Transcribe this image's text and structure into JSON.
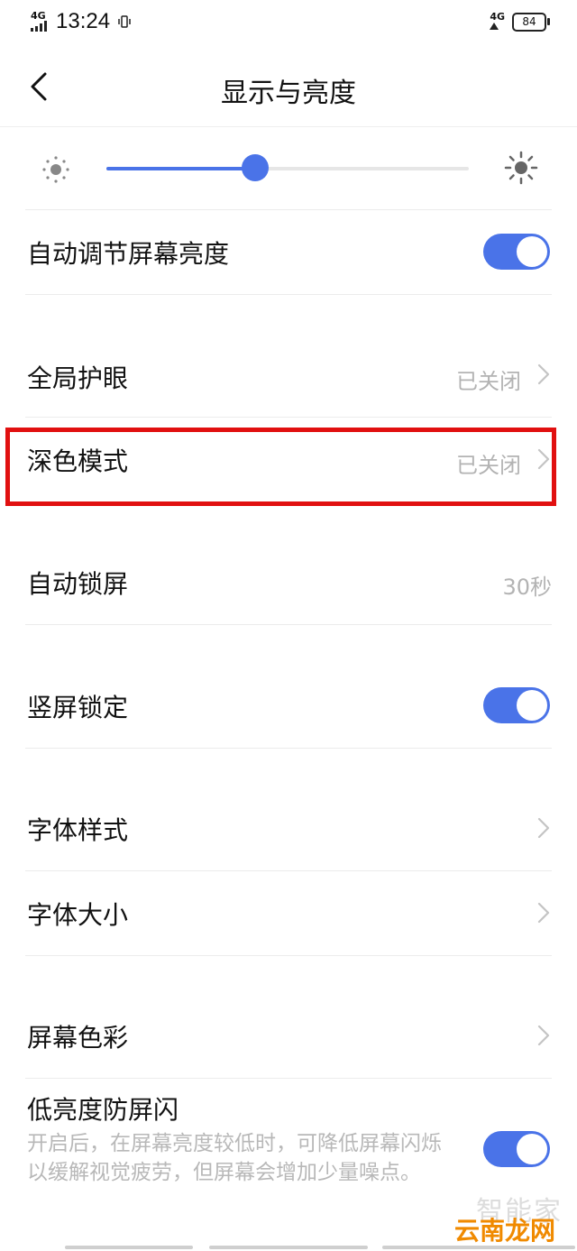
{
  "status_bar": {
    "network_left": "4G",
    "time": "13:24",
    "network_right": "4G",
    "battery": "84"
  },
  "header": {
    "title": "显示与亮度"
  },
  "brightness": {
    "level": 0.41
  },
  "settings": {
    "auto_brightness": {
      "label": "自动调节屏幕亮度",
      "enabled": true
    },
    "eye_protection": {
      "label": "全局护眼",
      "value": "已关闭"
    },
    "dark_mode": {
      "label": "深色模式",
      "value": "已关闭"
    },
    "auto_lock": {
      "label": "自动锁屏",
      "value": "30秒"
    },
    "portrait_lock": {
      "label": "竖屏锁定",
      "enabled": true
    },
    "font_style": {
      "label": "字体样式"
    },
    "font_size": {
      "label": "字体大小"
    },
    "screen_color": {
      "label": "屏幕色彩"
    },
    "low_brightness_flicker": {
      "label": "低亮度防屏闪",
      "description": "开启后，在屏幕亮度较低时，可降低屏幕闪烁以缓解视觉疲劳，但屏幕会增加少量噪点。",
      "enabled": true
    }
  },
  "watermark": {
    "line1": "智能家",
    "line2": "云南龙网"
  },
  "colors": {
    "accent": "#4a73e8",
    "highlight": "#e11010",
    "secondary_text": "#b3b3b3"
  }
}
